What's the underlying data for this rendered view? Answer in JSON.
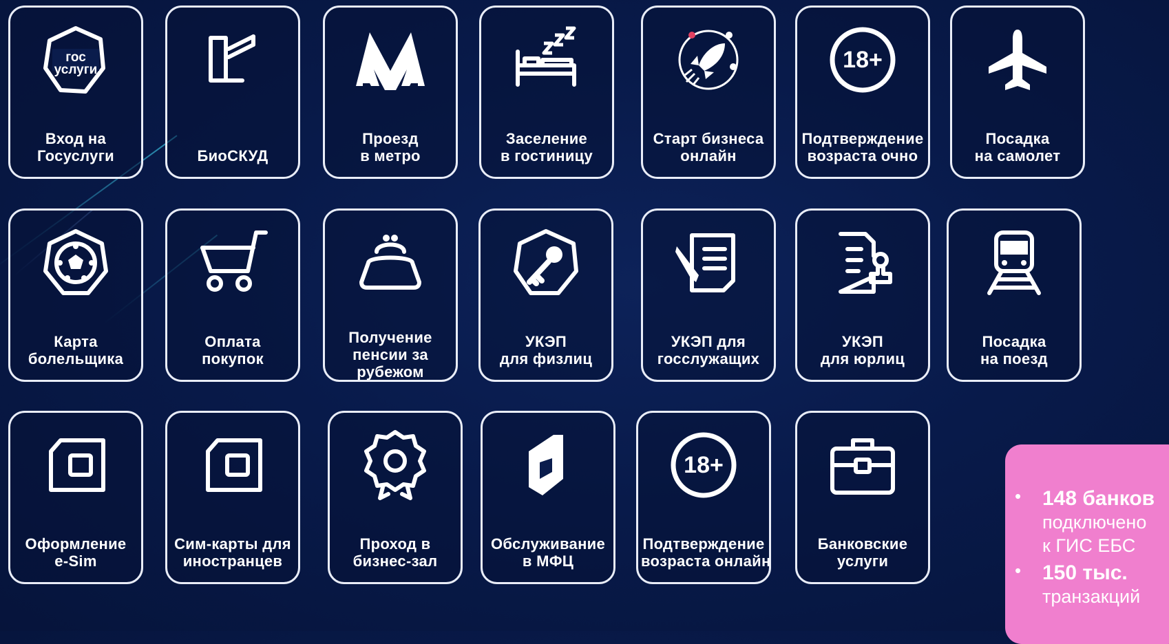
{
  "colors": {
    "background": "#081a4a",
    "tile_border": "#e9edf8",
    "icon": "#ffffff",
    "promo_background": "#f07fce"
  },
  "rows": [
    [
      {
        "icon": "gosuslugi-logo-icon",
        "label": [
          "Вход на",
          "Госуслуги"
        ],
        "logo_text": [
          "гос",
          "услуги"
        ]
      },
      {
        "icon": "turnstile-barrier-icon",
        "label": [
          "БиоСКУД"
        ]
      },
      {
        "icon": "metro-m-icon",
        "label": [
          "Проезд",
          "в метро"
        ]
      },
      {
        "icon": "bed-zzz-icon",
        "label": [
          "Заселение",
          "в гостиницу"
        ]
      },
      {
        "icon": "rocket-icon",
        "label": [
          "Старт бизнеса",
          "онлайн"
        ]
      },
      {
        "icon": "age-18-icon",
        "label": [
          "Подтверждение",
          "возраста очно"
        ],
        "badge": "18+"
      },
      {
        "icon": "airplane-icon",
        "label": [
          "Посадка",
          "на самолет"
        ]
      }
    ],
    [
      {
        "icon": "football-badge-icon",
        "label": [
          "Карта",
          "болельщика"
        ]
      },
      {
        "icon": "shopping-cart-icon",
        "label": [
          "Оплата",
          "покупок"
        ]
      },
      {
        "icon": "purse-icon",
        "label": [
          "Получение",
          "пенсии за",
          "рубежом"
        ]
      },
      {
        "icon": "key-shield-icon",
        "label": [
          "УКЭП",
          "для физлиц"
        ]
      },
      {
        "icon": "document-pen-icon",
        "label": [
          "УКЭП для",
          "госслужащих"
        ]
      },
      {
        "icon": "document-stamp-icon",
        "label": [
          "УКЭП",
          "для юрлиц"
        ]
      },
      {
        "icon": "train-icon",
        "label": [
          "Посадка",
          "на поезд"
        ]
      }
    ],
    [
      {
        "icon": "esim-card-icon",
        "label": [
          "Оформление",
          "e-Sim"
        ]
      },
      {
        "icon": "sim-card-icon",
        "label": [
          "Сим-карты для",
          "иностранцев"
        ]
      },
      {
        "icon": "award-rosette-icon",
        "label": [
          "Проход в",
          "бизнес-зал"
        ]
      },
      {
        "icon": "mfc-logo-icon",
        "label": [
          "Обслуживание",
          "в МФЦ"
        ]
      },
      {
        "icon": "age-18-icon",
        "label": [
          "Подтверждение",
          "возраста онлайн"
        ],
        "badge": "18+"
      },
      {
        "icon": "briefcase-icon",
        "label": [
          "Банковские",
          "услуги"
        ]
      }
    ]
  ],
  "promo": {
    "items": [
      {
        "value": "148 банков",
        "caption": [
          "подключено",
          "к ГИС ЕБС"
        ]
      },
      {
        "value": "150 тыс.",
        "caption": [
          "транзакций"
        ]
      }
    ]
  }
}
